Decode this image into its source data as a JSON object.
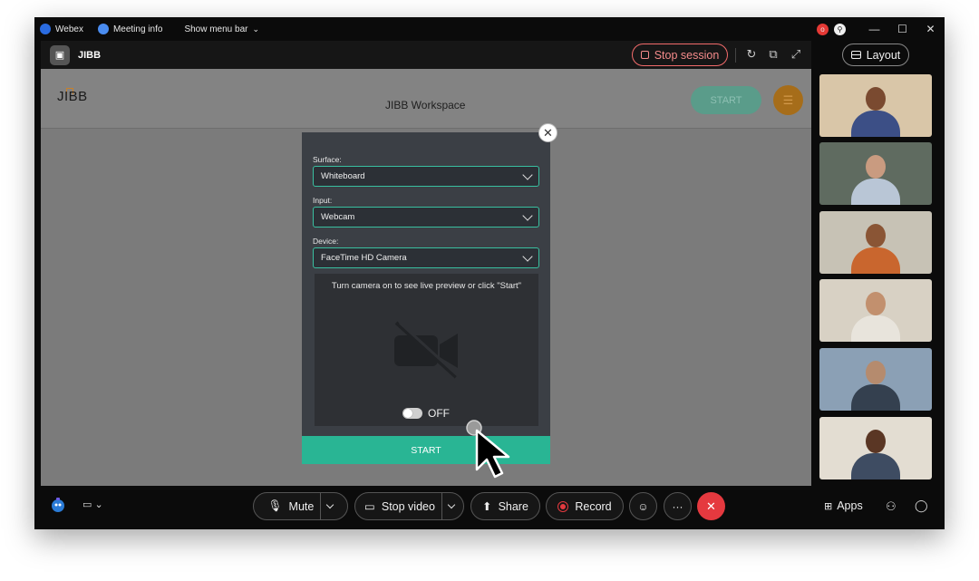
{
  "titlebar": {
    "app_name": "Webex",
    "meeting_info": "Meeting info",
    "show_menu_bar": "Show menu bar",
    "badge_red": "o",
    "win_minimize": "—",
    "win_maximize": "☐",
    "win_close": "✕"
  },
  "share_header": {
    "app_name": "JIBB",
    "stop_session": "Stop session"
  },
  "workspace": {
    "logo": "JIBB",
    "title": "JIBB Workspace",
    "start": "START"
  },
  "modal": {
    "surface_label": "Surface:",
    "surface_value": "Whiteboard",
    "input_label": "Input:",
    "input_value": "Webcam",
    "device_label": "Device:",
    "device_value": "FaceTime HD Camera",
    "preview_text": "Turn camera on to see live preview or click \"Start\"",
    "toggle_label": "OFF",
    "start": "START"
  },
  "sidebar": {
    "layout_label": "Layout",
    "thumb_colors": [
      {
        "bg": "#d9c6a8",
        "skin": "#7a4a30",
        "shirt": "#3c4f86"
      },
      {
        "bg": "#5f6b60",
        "skin": "#c99b80",
        "shirt": "#b9c6d6"
      },
      {
        "bg": "#c7c2b5",
        "skin": "#8a5535",
        "shirt": "#c9662e"
      },
      {
        "bg": "#d8d1c4",
        "skin": "#c2906e",
        "shirt": "#e8e4dc"
      },
      {
        "bg": "#8ba0b5",
        "skin": "#b58b6e",
        "shirt": "#34404f"
      },
      {
        "bg": "#e3ddd2",
        "skin": "#5a3624",
        "shirt": "#3e4c62"
      }
    ]
  },
  "controls": {
    "mute": "Mute",
    "stop_video": "Stop video",
    "share": "Share",
    "record": "Record",
    "more": "···",
    "apps": "Apps"
  }
}
